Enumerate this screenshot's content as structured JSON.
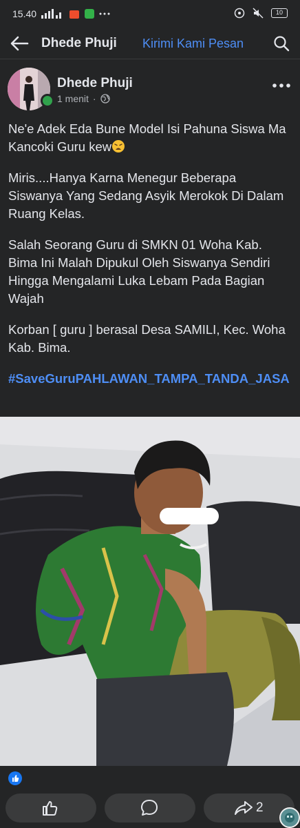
{
  "status_bar": {
    "time": "15.40",
    "battery": "10"
  },
  "header": {
    "title": "Dhede Phuji",
    "link": "Kirimi Kami Pesan"
  },
  "post": {
    "author": "Dhede Phuji",
    "time": "1 menit",
    "separator": "·",
    "paragraphs": [
      "Ne'e Adek Eda Bune Model Isi Pahuna Siswa Ma Kancoki Guru kew",
      "Miris....Hanya Karna Menegur  Beberapa Siswanya Yang Sedang Asyik Merokok Di Dalam Ruang Kelas.",
      "Salah Seorang Guru di SMKN 01 Woha Kab. Bima Ini Malah Dipukul Oleh Siswanya Sendiri Hingga Mengalami Luka Lebam Pada Bagian Wajah",
      "Korban [ guru ]  berasal Desa SAMILI, Kec. Woha Kab. Bima."
    ],
    "hashtag": "#SaveGuruPAHLAWAN_TAMPA_TANDA_JASA",
    "share_count": "2"
  },
  "icons": {
    "back": "arrow-left-icon",
    "search": "search-icon",
    "more": "more-dots-icon",
    "globe": "globe-icon",
    "like": "thumbs-up-icon",
    "comment": "comment-icon",
    "share": "share-icon"
  },
  "colors": {
    "background": "#242526",
    "link": "#4e8ef5",
    "online": "#31a24c",
    "like_badge": "#1877f2",
    "button": "#3a3b3c"
  }
}
